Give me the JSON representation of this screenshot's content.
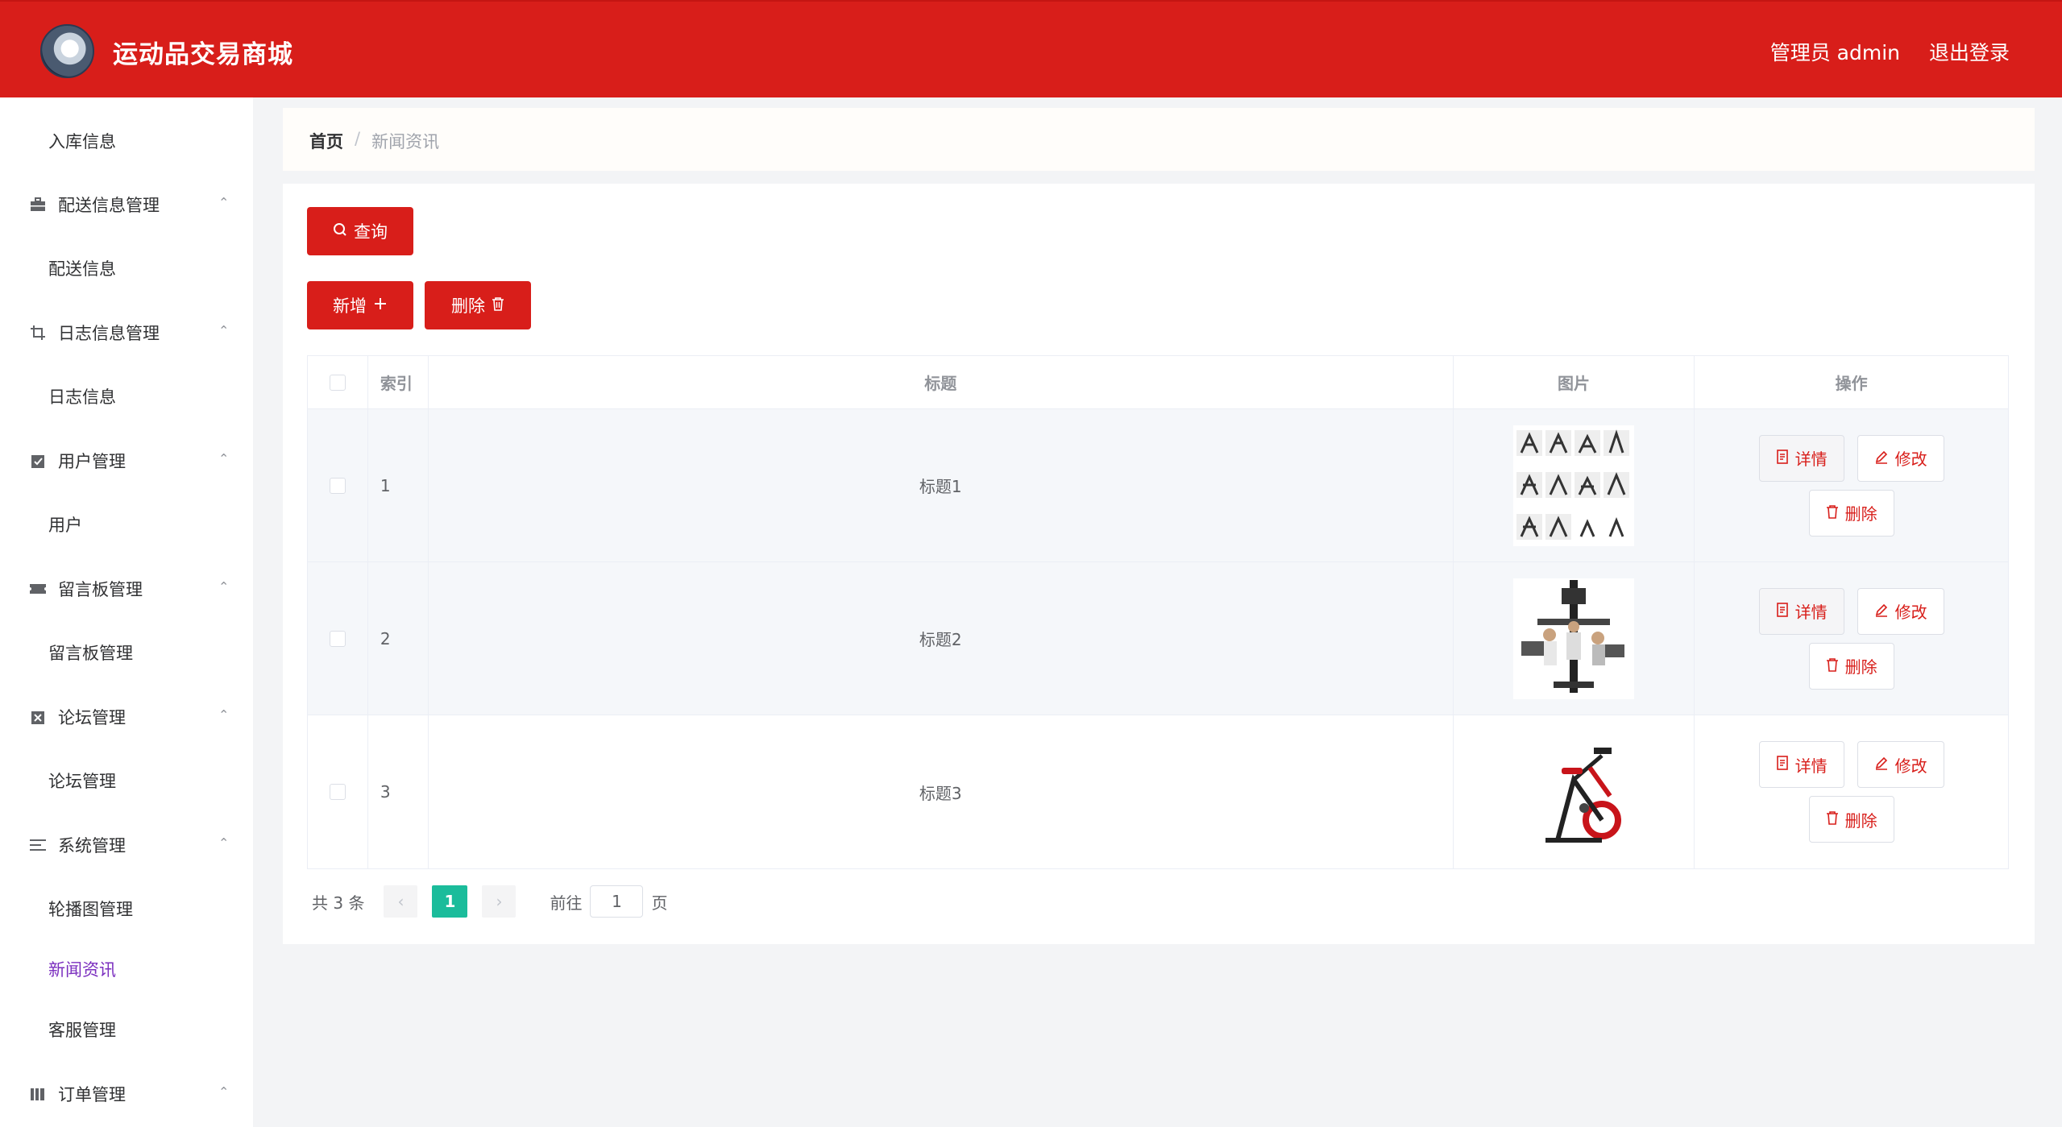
{
  "header": {
    "app_title": "运动品交易商城",
    "user_label": "管理员 admin",
    "logout_label": "退出登录"
  },
  "sidebar": {
    "items": [
      {
        "type": "sub",
        "label": "入库信息"
      },
      {
        "type": "group",
        "label": "配送信息管理",
        "icon": "briefcase-icon"
      },
      {
        "type": "sub",
        "label": "配送信息"
      },
      {
        "type": "group",
        "label": "日志信息管理",
        "icon": "crop-icon"
      },
      {
        "type": "sub",
        "label": "日志信息"
      },
      {
        "type": "group",
        "label": "用户管理",
        "icon": "checked-clipboard-icon"
      },
      {
        "type": "sub",
        "label": "用户"
      },
      {
        "type": "group",
        "label": "留言板管理",
        "icon": "ticket-icon"
      },
      {
        "type": "sub",
        "label": "留言板管理"
      },
      {
        "type": "group",
        "label": "论坛管理",
        "icon": "cross-box-icon"
      },
      {
        "type": "sub",
        "label": "论坛管理"
      },
      {
        "type": "group",
        "label": "系统管理",
        "icon": "menu-icon"
      },
      {
        "type": "sub",
        "label": "轮播图管理"
      },
      {
        "type": "sub",
        "label": "新闻资讯",
        "active": true
      },
      {
        "type": "sub",
        "label": "客服管理"
      },
      {
        "type": "group",
        "label": "订单管理",
        "icon": "books-icon"
      }
    ]
  },
  "breadcrumb": {
    "home": "首页",
    "separator": "/",
    "current": "新闻资讯"
  },
  "toolbar": {
    "search_label": "查询",
    "add_label": "新增",
    "delete_label": "删除"
  },
  "table": {
    "headers": {
      "index": "索引",
      "title": "标题",
      "image": "图片",
      "actions": "操作"
    },
    "rows": [
      {
        "index": "1",
        "title": "标题1",
        "image": "exercise-grid-image"
      },
      {
        "index": "2",
        "title": "标题2",
        "image": "home-gym-image"
      },
      {
        "index": "3",
        "title": "标题3",
        "image": "spin-bike-image"
      }
    ],
    "row_actions": {
      "detail": "详情",
      "edit": "修改",
      "delete": "删除"
    }
  },
  "pagination": {
    "total_text": "共 3 条",
    "current_page": "1",
    "goto_prefix": "前往",
    "goto_value": "1",
    "goto_suffix": "页"
  },
  "colors": {
    "brand_red": "#d81e1a",
    "active_page": "#1bbc9b",
    "active_menu": "#7b2fbf"
  }
}
